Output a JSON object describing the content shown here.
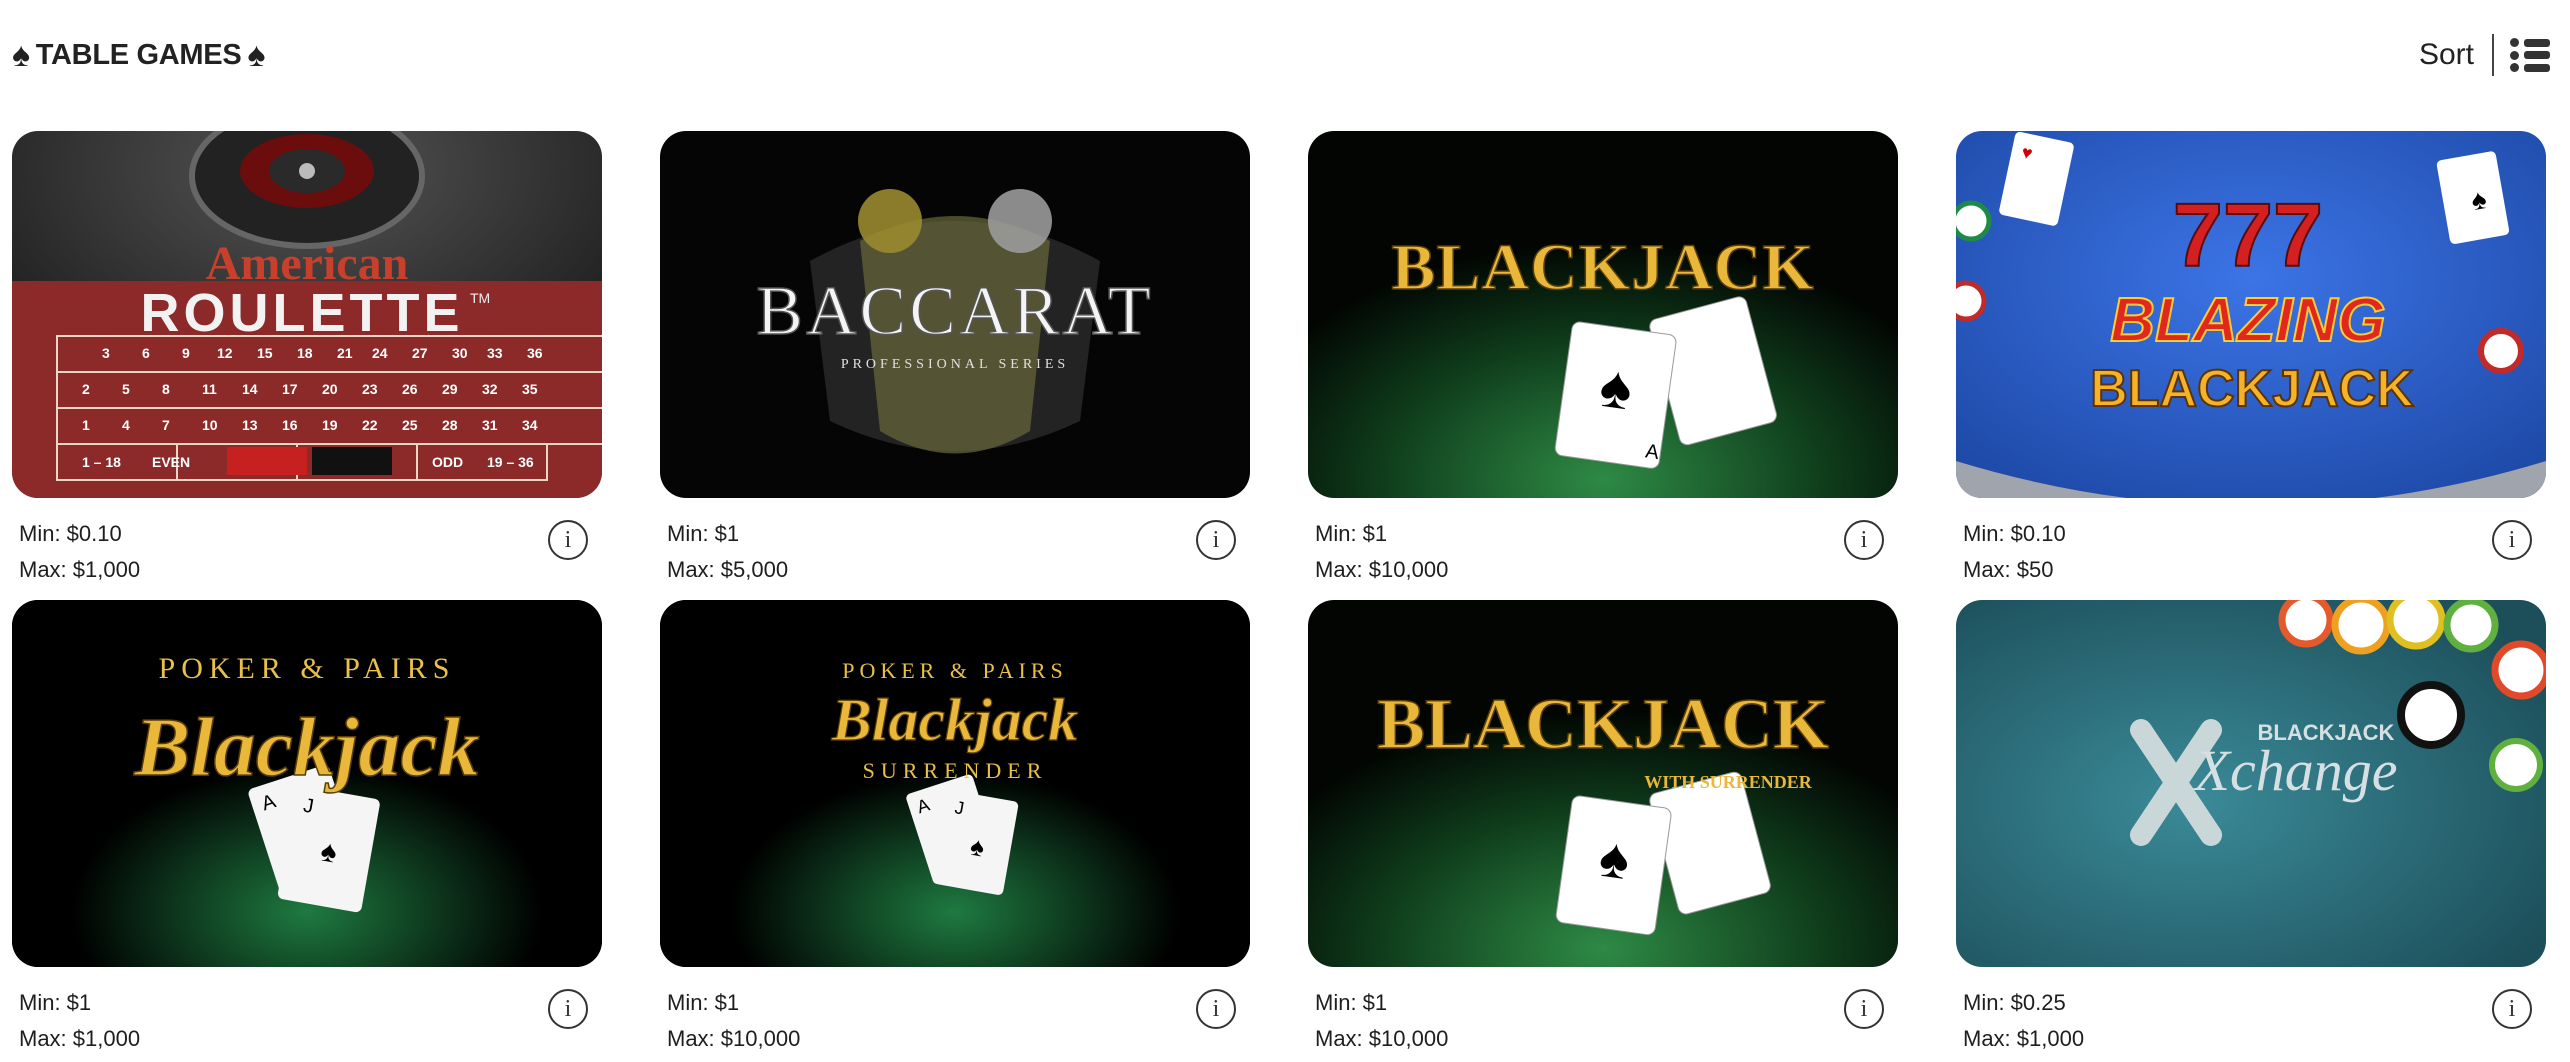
{
  "header": {
    "title": "TABLE GAMES",
    "sort_label": "Sort"
  },
  "games": [
    {
      "name": "American Roulette",
      "min": "Min: $0.10",
      "max": "Max: $1,000",
      "art": {
        "line1": "American",
        "line2": "ROULETTE",
        "tm": "TM"
      }
    },
    {
      "name": "Baccarat",
      "min": "Min: $1",
      "max": "Max: $5,000",
      "art": {
        "line1": "BACCARAT",
        "line2": "PROFESSIONAL SERIES"
      }
    },
    {
      "name": "Blackjack",
      "min": "Min: $1",
      "max": "Max: $10,000",
      "art": {
        "line1": "BLACKJACK"
      }
    },
    {
      "name": "Blazing Blackjack",
      "min": "Min: $0.10",
      "max": "Max: $50",
      "art": {
        "line0": "777",
        "line1": "BLAZING",
        "line2": "BLACKJACK"
      }
    },
    {
      "name": "Poker & Pairs Blackjack",
      "min": "Min: $1",
      "max": "Max: $1,000",
      "art": {
        "line0": "POKER & PAIRS",
        "line1": "Blackjack"
      }
    },
    {
      "name": "Poker & Pairs Blackjack Surrender",
      "min": "Min: $1",
      "max": "Max: $10,000",
      "art": {
        "line0": "POKER & PAIRS",
        "line1": "Blackjack",
        "line2": "SURRENDER"
      }
    },
    {
      "name": "Blackjack with Surrender",
      "min": "Min: $1",
      "max": "Max: $10,000",
      "art": {
        "line1": "BLACKJACK",
        "line2": "WITH SURRENDER"
      }
    },
    {
      "name": "Blackjack Xchange",
      "min": "Min: $0.25",
      "max": "Max: $1,000",
      "art": {
        "line0": "BLACKJACK",
        "line1": "Xchange"
      }
    }
  ],
  "colors": {
    "roulette_felt": "#8c2a2a",
    "blackjack_green": "#1f6b34",
    "blazing_blue": "#2e5fd0",
    "xchange_teal": "#2b6f7c",
    "gold": "#e9b73a"
  }
}
